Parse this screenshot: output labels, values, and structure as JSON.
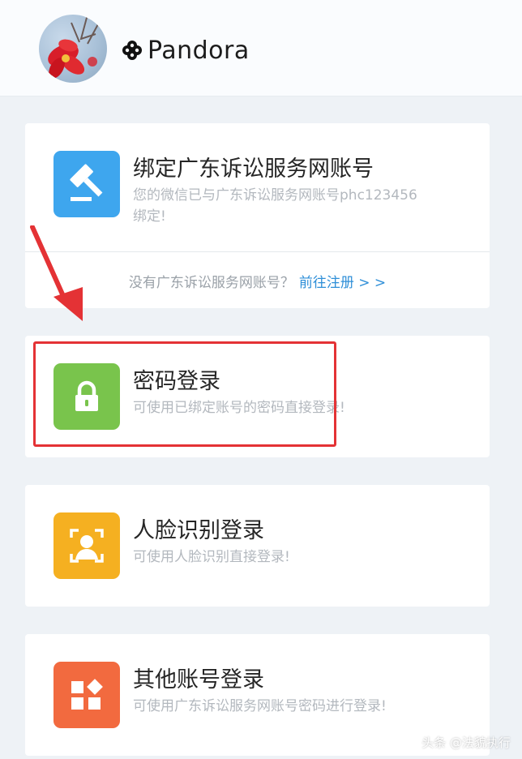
{
  "header": {
    "username": "Pandora"
  },
  "options": [
    {
      "title": "绑定广东诉讼服务网账号",
      "desc_line1": "您的微信已与广东诉讼服务网账号phc123456",
      "desc_line2": "绑定!",
      "icon": "gavel-icon",
      "color": "#3ea6ee"
    },
    {
      "title": "密码登录",
      "desc_line1": "可使用已绑定账号的密码直接登录!",
      "icon": "lock-icon",
      "color": "#79c44c"
    },
    {
      "title": "人脸识别登录",
      "desc_line1": "可使用人脸识别直接登录!",
      "icon": "face-scan-icon",
      "color": "#f5b021"
    },
    {
      "title": "其他账号登录",
      "desc_line1": "可使用广东诉讼服务网账号密码进行登录!",
      "icon": "apps-icon",
      "color": "#f26a3f"
    }
  ],
  "register": {
    "prompt": "没有广东诉讼服务网账号？",
    "link": "前往注册 > >"
  },
  "watermark": "头条 @法貌执行",
  "annotation": {
    "highlight_color": "#e43235"
  }
}
